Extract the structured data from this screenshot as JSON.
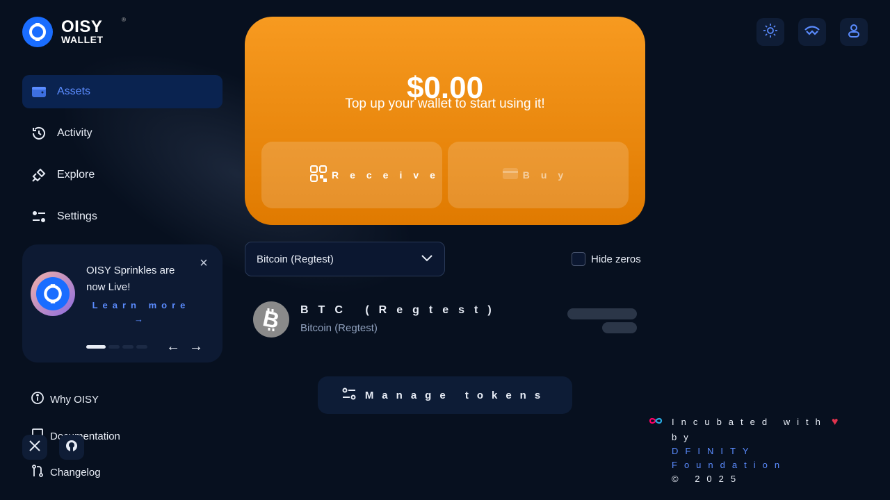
{
  "brand": {
    "name_line1": "OISY",
    "name_line2": "WALLET",
    "registered": "®"
  },
  "nav": {
    "items": [
      {
        "label": "Assets",
        "active": true
      },
      {
        "label": "Activity",
        "active": false
      },
      {
        "label": "Explore",
        "active": false
      },
      {
        "label": "Settings",
        "active": false
      }
    ]
  },
  "promo": {
    "title": "OISY Sprinkles are now Live!",
    "link": "Learn more →",
    "close": "×",
    "prev": "←",
    "next": "→"
  },
  "links": {
    "why": "Why OISY",
    "documentation": "Documentation",
    "changelog": "Changelog"
  },
  "balance": {
    "amount": "$0.00",
    "subtitle": "Top up your wallet to start using it!",
    "receive_label": "Receive",
    "buy_label": "Buy"
  },
  "network_select": {
    "value": "Bitcoin (Regtest)"
  },
  "hide_zeros": {
    "label": "Hide zeros",
    "checked": false
  },
  "tokens": [
    {
      "symbol": "BTC (Regtest)",
      "network": "Bitcoin (Regtest)"
    }
  ],
  "manage_tokens": {
    "label": "Manage tokens"
  },
  "footer": {
    "incubated": "Incubated with",
    "by": "by",
    "org_line1": "DFINITY",
    "org_line2": "Foundation",
    "copyright": "© 2025"
  },
  "colors": {
    "background": "#07101f",
    "accent": "#5b8cff",
    "brand_blue": "#1a6dff",
    "card_orange": "#f79a20"
  }
}
